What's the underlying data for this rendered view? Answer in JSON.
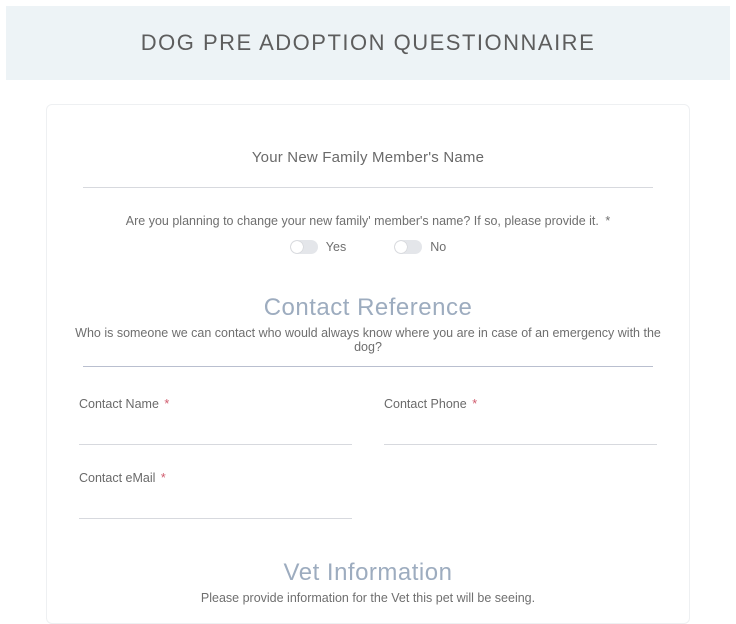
{
  "title": "DOG PRE ADOPTION QUESTIONNAIRE",
  "petName": {
    "placeholder": "Your New Family Member's Name"
  },
  "changeName": {
    "question": "Are you planning to change your new family' member's name? If so, please provide it.",
    "required": "*",
    "options": {
      "yes": "Yes",
      "no": "No"
    }
  },
  "sections": {
    "contactRef": {
      "heading": "Contact Reference",
      "desc": "Who is someone we can contact who would always know where you are in case of an emergency with the dog?",
      "fields": {
        "name": {
          "label": "Contact Name",
          "req": "*"
        },
        "phone": {
          "label": "Contact Phone",
          "req": "*"
        },
        "email": {
          "label": "Contact eMail",
          "req": "*"
        }
      }
    },
    "vetInfo": {
      "heading": "Vet Information",
      "desc": "Please provide information for the Vet this pet will be seeing."
    }
  }
}
